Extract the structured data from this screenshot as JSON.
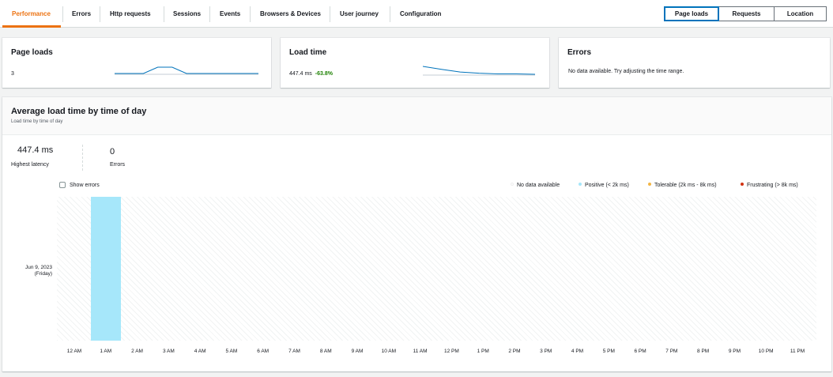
{
  "tabs": [
    {
      "label": "Performance",
      "active": true
    },
    {
      "label": "Errors"
    },
    {
      "label": "Http requests"
    },
    {
      "label": "Sessions"
    },
    {
      "label": "Events"
    },
    {
      "label": "Browsers & Devices"
    },
    {
      "label": "User journey"
    },
    {
      "label": "Configuration"
    }
  ],
  "view_toggle": {
    "options": [
      "Page loads",
      "Requests",
      "Location"
    ],
    "selected": "Page loads"
  },
  "cards": {
    "page_loads": {
      "title": "Page loads",
      "value": "3"
    },
    "load_time": {
      "title": "Load time",
      "value": "447.4 ms",
      "change": "-63.8%"
    },
    "errors": {
      "title": "Errors",
      "message": "No data available. Try adjusting the time range."
    }
  },
  "panel": {
    "title": "Average load time by time of day",
    "subtitle": "Load time by time of day",
    "stats": [
      {
        "value": "447.4 ms",
        "label": "Highest latency"
      },
      {
        "value": "0",
        "label": "Errors"
      }
    ],
    "show_errors_label": "Show errors",
    "legend": [
      {
        "label": "No data available",
        "color": "#ffffff"
      },
      {
        "label": "Positive (< 2k ms)",
        "color": "#a6e7fa"
      },
      {
        "label": "Tolerable (2k ms - 8k ms)",
        "color": "#f2b544"
      },
      {
        "label": "Frustrating (> 8k ms)",
        "color": "#d13212"
      }
    ],
    "row_label": [
      "Jun 9, 2023",
      "(Friday)"
    ]
  },
  "chart_data": {
    "type": "heatmap",
    "title": "Average load time by time of day",
    "subtitle": "Load time by time of day",
    "x": [
      "12 AM",
      "1 AM",
      "2 AM",
      "3 AM",
      "4 AM",
      "5 AM",
      "6 AM",
      "7 AM",
      "8 AM",
      "9 AM",
      "10 AM",
      "11 AM",
      "12 PM",
      "1 PM",
      "2 PM",
      "3 PM",
      "4 PM",
      "5 PM",
      "6 PM",
      "7 PM",
      "8 PM",
      "9 PM",
      "10 PM",
      "11 PM"
    ],
    "y": [
      "Jun 9, 2023 (Friday)"
    ],
    "cells": [
      {
        "x": "1 AM",
        "y": "Jun 9, 2023 (Friday)",
        "category": "Positive (< 2k ms)",
        "color": "#a6e7fa"
      }
    ],
    "legend_placement": "top-right"
  },
  "sparklines": {
    "page_loads": [
      1,
      1,
      1,
      2,
      2,
      1,
      1,
      1,
      1,
      1,
      1
    ],
    "load_time": [
      1.0,
      0.92,
      0.85,
      0.82,
      0.8,
      0.8,
      0.79
    ]
  }
}
